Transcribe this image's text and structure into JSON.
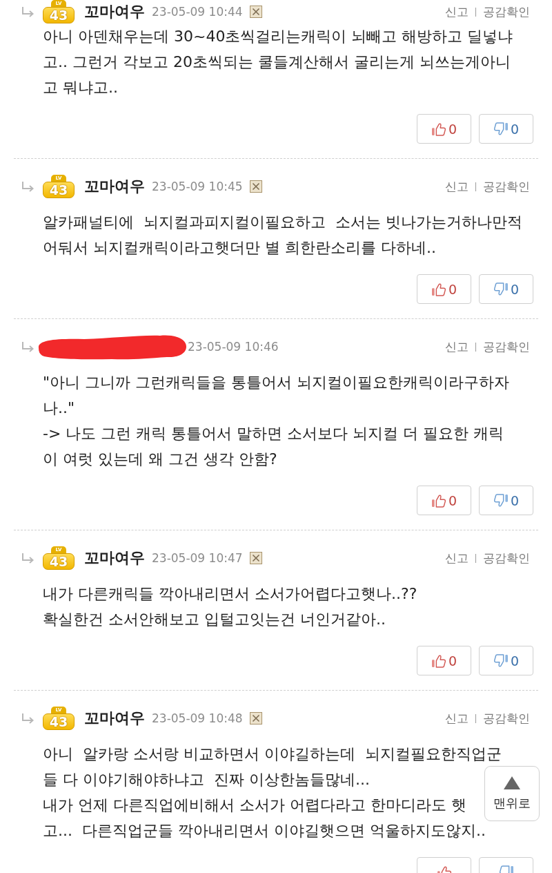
{
  "comments": [
    {
      "reply": true,
      "redacted": false,
      "author": {
        "level_label": "LV",
        "level": "43",
        "nickname": "꼬마여우"
      },
      "date": "23-05-09 10:44",
      "actions": [
        "신고",
        "공감확인"
      ],
      "body_lines": [
        "아니 아덴채우는데 30~40초씩걸리는캐릭이 뇌빼고 해방하고 딜넣냐",
        "고.. 그런거 각보고 20초씩되는 쿨들계산해서 굴리는게 뇌쓰는게아니",
        "고 뭐냐고.."
      ],
      "likes": "0",
      "dislikes": "0"
    },
    {
      "reply": true,
      "redacted": false,
      "author": {
        "level_label": "LV",
        "level": "43",
        "nickname": "꼬마여우"
      },
      "date": "23-05-09 10:45",
      "actions": [
        "신고",
        "공감확인"
      ],
      "body_lines": [
        "알카패널티에  뇌지컬과피지컬이필요하고  소서는 빗나가는거하나만적",
        "어둬서 뇌지컬캐릭이라고햇더만 별 희한란소리를 다하네.."
      ],
      "likes": "0",
      "dislikes": "0"
    },
    {
      "reply": true,
      "redacted": true,
      "date": "23-05-09 10:46",
      "actions": [
        "신고",
        "공감확인"
      ],
      "body_lines": [
        "\"아니 그니까 그런캐릭들을 통틀어서 뇌지컬이필요한캐릭이라구하자",
        "나..\"",
        "-> 나도 그런 캐릭 통틀어서 말하면 소서보다 뇌지컬 더 필요한 캐릭",
        "이 여럿 있는데 왜 그건 생각 안함?"
      ],
      "likes": "0",
      "dislikes": "0"
    },
    {
      "reply": true,
      "redacted": false,
      "author": {
        "level_label": "LV",
        "level": "43",
        "nickname": "꼬마여우"
      },
      "date": "23-05-09 10:47",
      "actions": [
        "신고",
        "공감확인"
      ],
      "body_lines": [
        "내가 다른캐릭들 깍아내리면서 소서가어렵다고햇나..??",
        "확실한건 소서안해보고 입털고잇는건 너인거같아.."
      ],
      "likes": "0",
      "dislikes": "0"
    },
    {
      "reply": true,
      "redacted": false,
      "author": {
        "level_label": "LV",
        "level": "43",
        "nickname": "꼬마여우"
      },
      "date": "23-05-09 10:48",
      "actions": [
        "신고",
        "공감확인"
      ],
      "body_lines": [
        "아니  알카랑 소서랑 비교하면서 이야길하는데  뇌지컬필요한직업군",
        "들 다 이야기해야하냐고  진짜 이상한놈들많네...",
        "내가 언제 다른직업에비해서 소서가 어렵다라고 한마디라도 햇",
        "고...  다른직업군들 깍아내리면서 이야길햇으면 억울하지도않지.."
      ]
    }
  ],
  "top_button": {
    "label": "맨위로"
  }
}
